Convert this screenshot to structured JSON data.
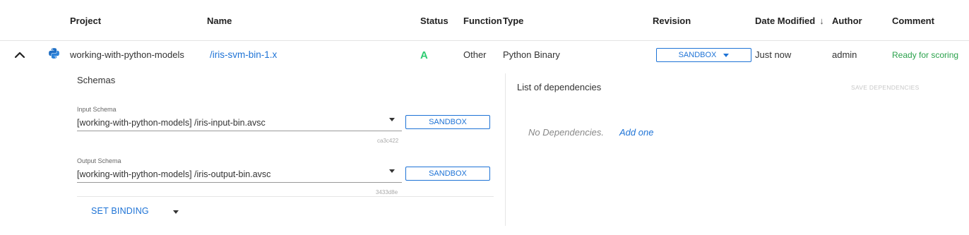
{
  "header": {
    "project": "Project",
    "name": "Name",
    "status": "Status",
    "function": "Function",
    "type": "Type",
    "revision": "Revision",
    "date_modified": "Date Modified",
    "sort_arrow": "↓",
    "author": "Author",
    "comment": "Comment"
  },
  "row": {
    "project": "working-with-python-models",
    "name": "/iris-svm-bin-1.x",
    "status": "A",
    "function": "Other",
    "type": "Python Binary",
    "revision": "SANDBOX",
    "date_modified": "Just now",
    "author": "admin",
    "comment": "Ready for scoring",
    "icon": "python-icon"
  },
  "schemas": {
    "title": "Schemas",
    "input": {
      "label": "Input Schema",
      "value": "[working-with-python-models] /iris-input-bin.avsc",
      "version": "SANDBOX",
      "hash": "ca3c422"
    },
    "output": {
      "label": "Output Schema",
      "value": "[working-with-python-models] /iris-output-bin.avsc",
      "version": "SANDBOX",
      "hash": "3433d8e"
    },
    "set_binding": "SET BINDING"
  },
  "dependencies": {
    "title": "List of dependencies",
    "save_label": "SAVE DEPENDENCIES",
    "empty_text": "No Dependencies.",
    "add_label": "Add one"
  },
  "colors": {
    "accent": "#1e73d6",
    "status_green": "#2ecc71",
    "comment_green": "#2ba24c"
  }
}
